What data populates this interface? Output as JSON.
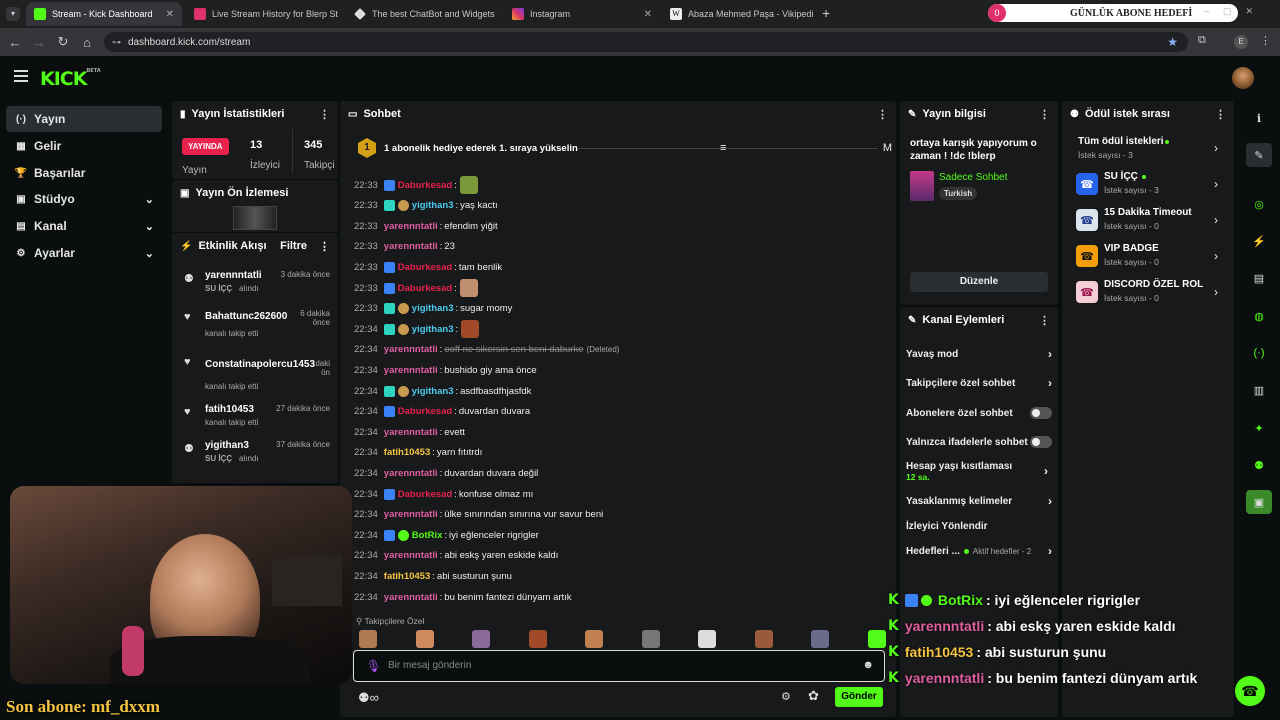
{
  "browser": {
    "tabs": [
      {
        "label": "Stream - Kick Dashboard",
        "color": "#53fc18"
      },
      {
        "label": "Live Stream History for Blerp St",
        "color": "#e0316d"
      },
      {
        "label": "The best ChatBot and Widgets",
        "color": "#dddddd"
      },
      {
        "label": "Instagram",
        "color": "#d6336c"
      },
      {
        "label": "Abaza Mehmed Paşa - Vikipedi",
        "color": "#eeeeee"
      }
    ],
    "new_tab": "+",
    "overlay_title": "GÜNLÜK ABONE HEDEFİ",
    "overlay_count": "0",
    "url": "dashboard.kick.com/stream",
    "profile_initial": "E"
  },
  "brand": {
    "logo": "KICK",
    "beta": "BETA"
  },
  "nav": [
    {
      "label": "Yayın",
      "icon": "(·)",
      "selected": true
    },
    {
      "label": "Gelir",
      "icon": "▦"
    },
    {
      "label": "Başarılar",
      "icon": "🏆"
    },
    {
      "label": "Stüdyo",
      "icon": "▣",
      "expand": true
    },
    {
      "label": "Kanal",
      "icon": "▤",
      "expand": true
    },
    {
      "label": "Ayarlar",
      "icon": "⚙",
      "expand": true
    }
  ],
  "stats": {
    "title": "Yayın İstatistikleri",
    "live_label": "YAYINDA",
    "live_sub": "Yayın",
    "viewers": "13",
    "viewers_label": "İzleyici",
    "followers": "345",
    "followers_label": "Takipçi"
  },
  "preview": {
    "title": "Yayın Ön İzlemesi"
  },
  "activity": {
    "title": "Etkinlik Akışı",
    "filter": "Filtre",
    "items": [
      {
        "name": "yarennntatli",
        "sub": "SU İÇÇ",
        "sub2": "alındı",
        "time": "3 dakika önce"
      },
      {
        "name": "Bahattunc262600",
        "sub": "kanalı takip etti",
        "time": "6 dakika önce"
      },
      {
        "name": "Constatinapolercu1453",
        "sub": "kanalı takip etti",
        "time": "daki ön"
      },
      {
        "name": "fatih10453",
        "sub": "kanalı takip etti",
        "time": "27 dakika önce"
      },
      {
        "name": "yigithan3",
        "sub": "SU İÇÇ",
        "sub2": "alındı",
        "time": "37 dakika önce"
      }
    ]
  },
  "chat": {
    "title": "Sohbet",
    "pin": "1 abonelik hediye ederek 1. sıraya yükselin",
    "pin_rank": "1",
    "pin_letter": "M",
    "messages": [
      {
        "time": "22:33",
        "user": "Daburkesad",
        "color": "#e8224d",
        "text": "",
        "emote": "#7a9a3a"
      },
      {
        "time": "22:33",
        "user": "yigithan3",
        "color": "#4ecbf0",
        "text": "yaş kactı"
      },
      {
        "time": "22:33",
        "user": "yarennntatli",
        "color": "#e05fa0",
        "text": "efendim yiğit"
      },
      {
        "time": "22:33",
        "user": "yarennntatli",
        "color": "#e05fa0",
        "text": "23"
      },
      {
        "time": "22:33",
        "user": "Daburkesad",
        "color": "#e8224d",
        "text": "tam benlik"
      },
      {
        "time": "22:33",
        "user": "Daburkesad",
        "color": "#e8224d",
        "text": "",
        "emote": "#c09070"
      },
      {
        "time": "22:33",
        "user": "yigithan3",
        "color": "#4ecbf0",
        "text": "sugar momy"
      },
      {
        "time": "22:34",
        "user": "yigithan3",
        "color": "#4ecbf0",
        "text": "",
        "emote": "#a04a2a"
      },
      {
        "time": "22:34",
        "user": "yarennntatli",
        "color": "#e05fa0",
        "text": "ooff ne sikersin sen beni daburke",
        "deleted": "(Deleted)"
      },
      {
        "time": "22:34",
        "user": "yarennntatli",
        "color": "#e05fa0",
        "text": "bushido giy ama önce"
      },
      {
        "time": "22:34",
        "user": "yigithan3",
        "color": "#4ecbf0",
        "text": "asdfbasdfhjasfdk"
      },
      {
        "time": "22:34",
        "user": "Daburkesad",
        "color": "#e8224d",
        "text": "duvardan duvara"
      },
      {
        "time": "22:34",
        "user": "yarennntatli",
        "color": "#e05fa0",
        "text": "evett"
      },
      {
        "time": "22:34",
        "user": "fatih10453",
        "color": "#f5c542",
        "text": "yarn fıtıtrdı"
      },
      {
        "time": "22:34",
        "user": "yarennntatli",
        "color": "#e05fa0",
        "text": "duvardan duvara değil"
      },
      {
        "time": "22:34",
        "user": "Daburkesad",
        "color": "#e8224d",
        "text": "konfuse olmaz mı"
      },
      {
        "time": "22:34",
        "user": "yarennntatli",
        "color": "#e05fa0",
        "text": "ülke sınırından sınırına vur savur beni"
      },
      {
        "time": "22:34",
        "user": "BotRix",
        "color": "#53fc18",
        "text": "iyi eğlenceler rigrigler"
      },
      {
        "time": "22:34",
        "user": "yarennntatli",
        "color": "#e05fa0",
        "text": "abi eskş yaren eskide kaldı"
      },
      {
        "time": "22:34",
        "user": "fatih10453",
        "color": "#f5c542",
        "text": "abi susturun şunu"
      },
      {
        "time": "22:34",
        "user": "yarennntatli",
        "color": "#e05fa0",
        "text": "bu benim fantezi dünyam artık"
      }
    ],
    "followers_only": "Takipçilere Özel",
    "placeholder": "Bir mesaj gönderin",
    "send": "Gönder"
  },
  "stream_info": {
    "title": "Yayın bilgisi",
    "stream_title": "ortaya karışık yapıyorum o zaman ! !dc !blerp",
    "category": "Sadece Sohbet",
    "language": "Turkish",
    "edit": "Düzenle"
  },
  "channel_actions": {
    "title": "Kanal Eylemleri",
    "items": [
      {
        "label": "Yavaş mod",
        "type": "chevron"
      },
      {
        "label": "Takipçilere özel sohbet",
        "type": "chevron"
      },
      {
        "label": "Abonelere özel sohbet",
        "type": "toggle"
      },
      {
        "label": "Yalnızca ifadelerle sohbet",
        "type": "toggle"
      },
      {
        "label": "Hesap yaşı kısıtlaması",
        "sub": "12 sa.",
        "type": "chevron"
      },
      {
        "label": "Yasaklanmış kelimeler",
        "type": "chevron"
      },
      {
        "label": "İzleyici Yönlendir",
        "type": "none"
      },
      {
        "label": "Hedefleri ...",
        "sub": "Aktif hedefler - 2",
        "type": "chevron"
      }
    ]
  },
  "rewards": {
    "title": "Ödül istek sırası",
    "all_label": "Tüm ödül istekleri",
    "all_sub": "İstek sayısı - 3",
    "items": [
      {
        "label": "SU İÇÇ",
        "sub": "İstek sayısı - 3",
        "color": "#2563eb",
        "icon": "☎",
        "dot": true
      },
      {
        "label": "15 Dakika Timeout",
        "sub": "İstek sayısı - 0",
        "color": "#dbe4ee",
        "icon": "☎"
      },
      {
        "label": "VIP BADGE",
        "sub": "İstek sayısı - 0",
        "color": "#f59e0b",
        "icon": "☎"
      },
      {
        "label": "DISCORD ÖZEL ROL",
        "sub": "İstek sayısı - 0",
        "color": "#f4cdd6",
        "icon": "☎"
      }
    ]
  },
  "overlay_chat": [
    {
      "user": "BotRix",
      "color": "#53fc18",
      "text": ": iyi eğlenceler rigrigler"
    },
    {
      "user": "yarennntatli",
      "color": "#e05fa0",
      "text": ": abi eskş yaren eskide kaldı"
    },
    {
      "user": "fatih10453",
      "color": "#f5c542",
      "text": ": abi susturun şunu"
    },
    {
      "user": "yarennntatli",
      "color": "#e05fa0",
      "text": ": bu benim fantezi dünyam artık"
    }
  ],
  "last_sub": "Son abone: mf_dxxm"
}
